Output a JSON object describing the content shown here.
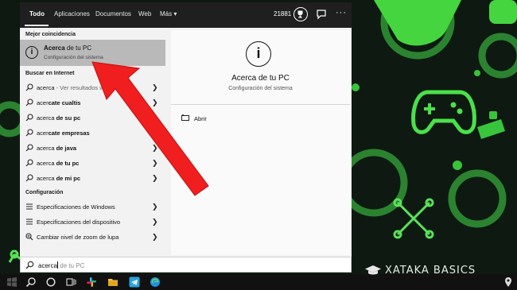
{
  "top_bar": {
    "tabs": [
      "Todo",
      "Aplicaciones",
      "Documentos",
      "Web",
      "Más ▾"
    ],
    "points": "21881"
  },
  "best_match": {
    "header": "Mejor coincidencia",
    "title_bold": "Acerca",
    "title_rest": " de tu PC",
    "subtitle": "Configuración del sistema"
  },
  "web_search": {
    "header": "Buscar en Internet",
    "items": [
      {
        "pre": "acerca",
        "bold": "",
        "post": " - Ver resultados web"
      },
      {
        "pre": "acer",
        "bold": "cate cualtis",
        "post": ""
      },
      {
        "pre": "acerca",
        "bold": " de su pc",
        "post": ""
      },
      {
        "pre": "acer",
        "bold": "cate empresas",
        "post": ""
      },
      {
        "pre": "acerca",
        "bold": " de java",
        "post": ""
      },
      {
        "pre": "acerca",
        "bold": " de tu pc",
        "post": ""
      },
      {
        "pre": "acerca",
        "bold": " de mi pc",
        "post": ""
      }
    ]
  },
  "settings": {
    "header": "Configuración",
    "items": [
      "Especificaciones de Windows",
      "Especificaciones del dispositivo",
      "Cambiar nivel de zoom de lupa"
    ]
  },
  "preview": {
    "title": "Acerca de tu PC",
    "subtitle": "Configuración del sistema",
    "open_label": "Abrir"
  },
  "search_box": {
    "typed": "acerca",
    "hint": " de tu PC"
  },
  "watermark": "XATAKA BASICS",
  "colors": {
    "accent_green": "#39d43a",
    "arrow_red": "#f01e1e",
    "selected_row": "#b9b9b9"
  }
}
